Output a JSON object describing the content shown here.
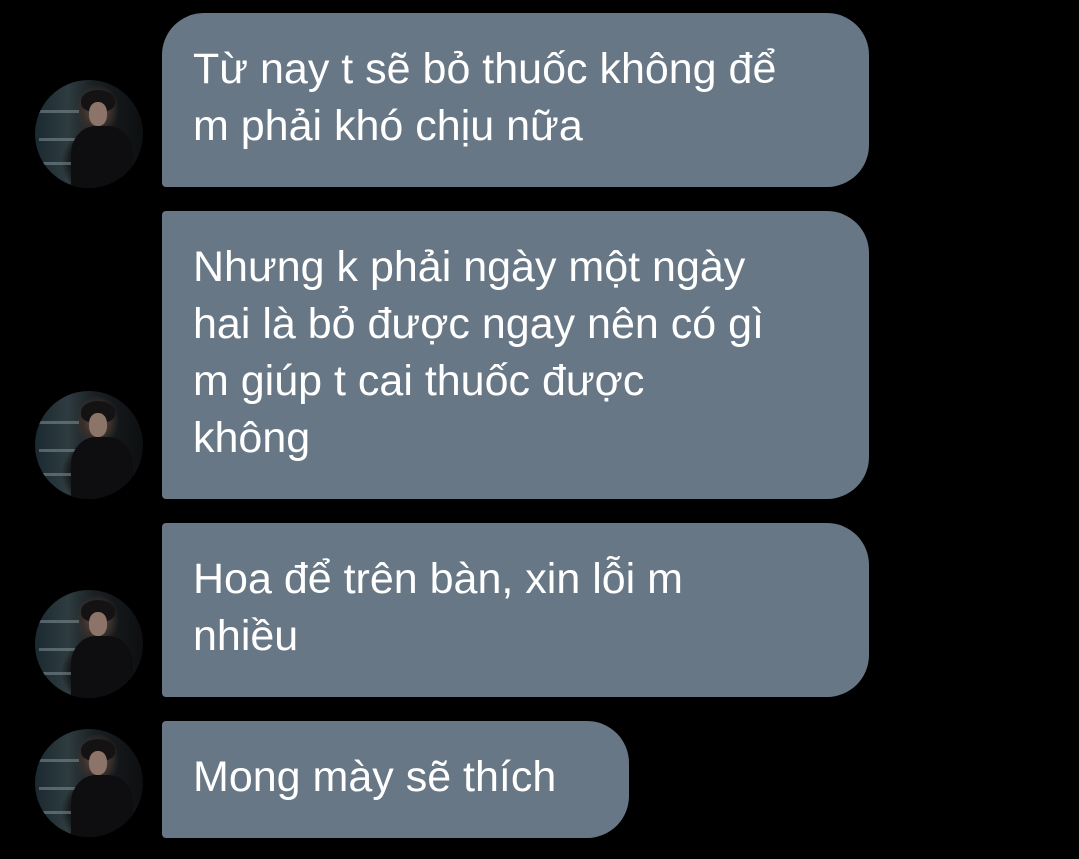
{
  "conversation": {
    "messages": [
      {
        "text": "Từ nay t sẽ bỏ thuốc không để\nm phải khó chịu nữa",
        "avatar": "sender-avatar"
      },
      {
        "text": "Nhưng k phải ngày một ngày\nhai là bỏ được ngay nên có gì\nm giúp t cai thuốc được\nkhông",
        "avatar": "sender-avatar"
      },
      {
        "text": "Hoa để trên bàn, xin lỗi m\nnhiều",
        "avatar": "sender-avatar"
      },
      {
        "text": "Mong mày sẽ thích",
        "avatar": "sender-avatar"
      }
    ]
  },
  "colors": {
    "background": "#000000",
    "bubble": "#687785",
    "text": "#ffffff"
  }
}
